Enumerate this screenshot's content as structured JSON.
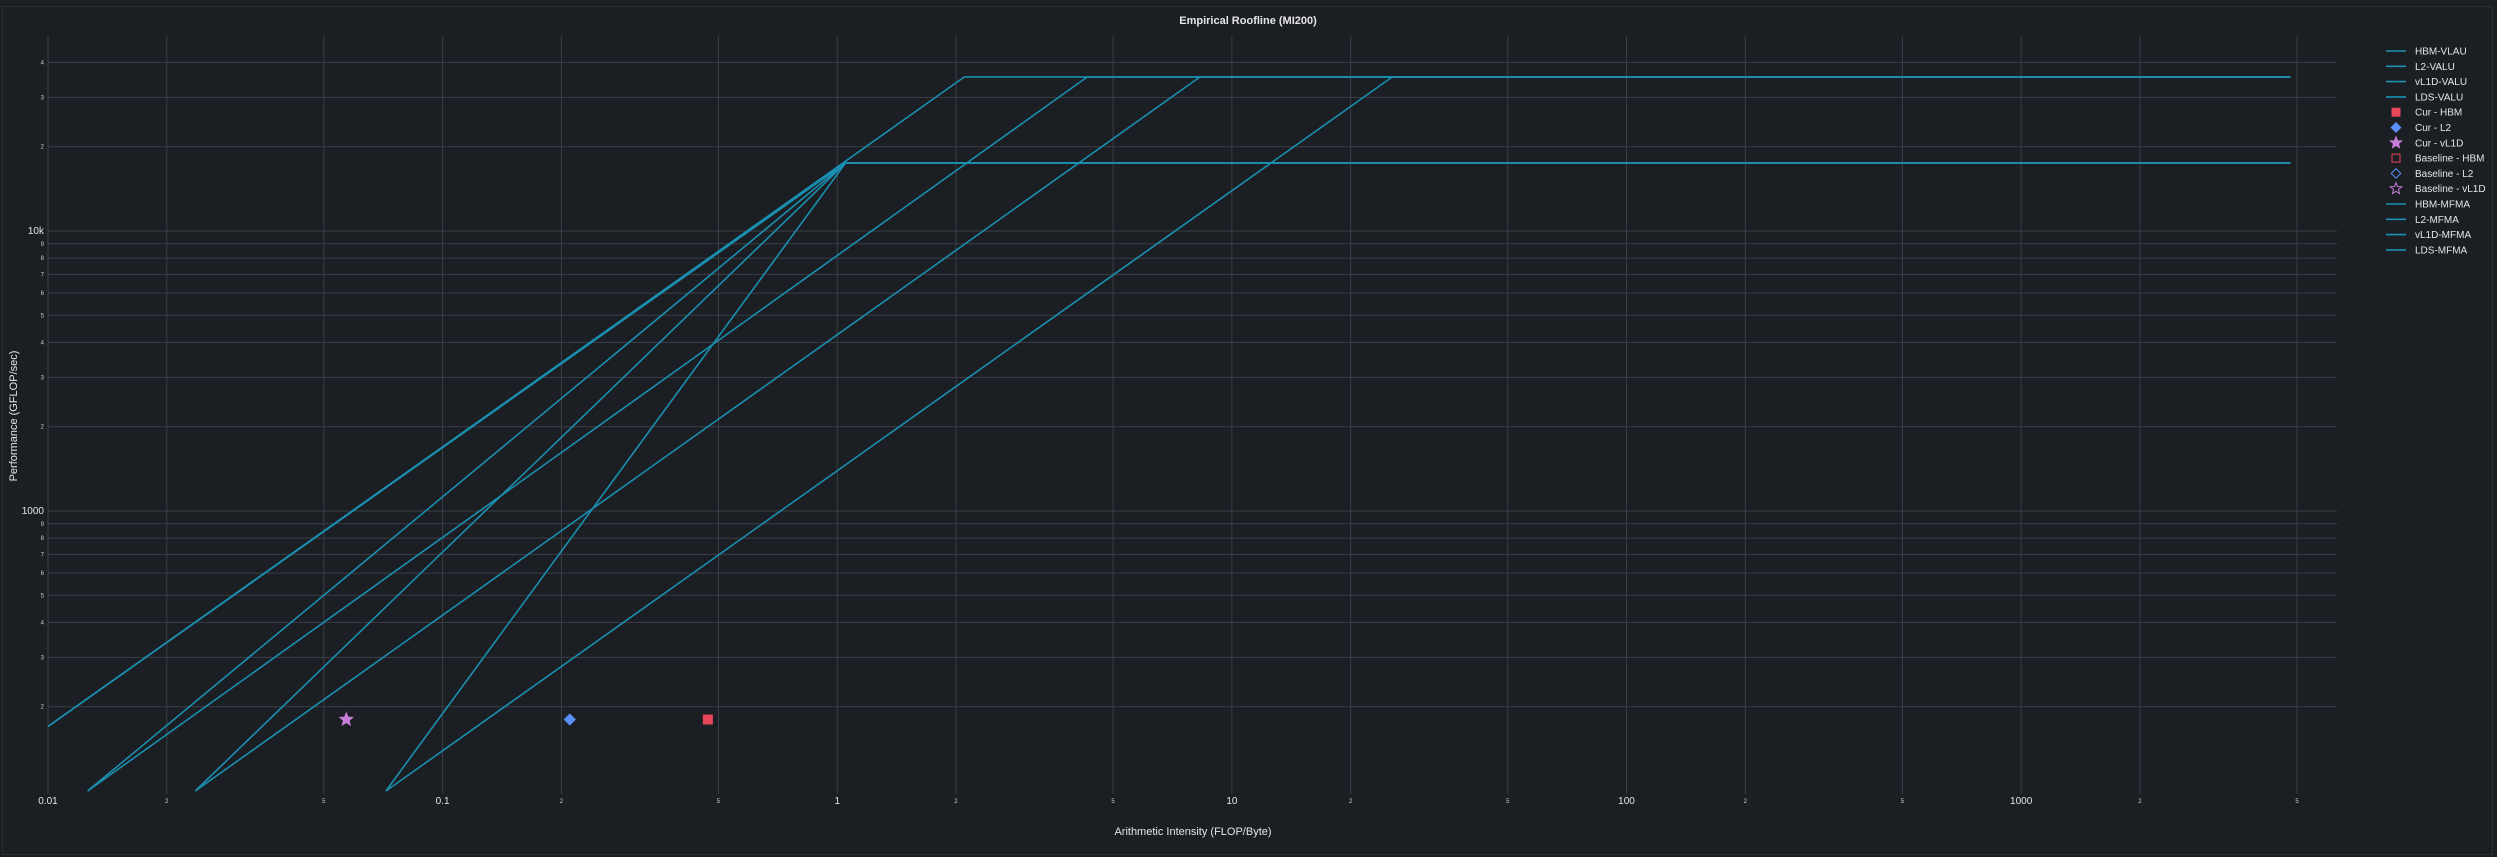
{
  "chart_data": {
    "type": "scatter",
    "title": "Empirical Roofline (MI200)",
    "xlabel": "Arithmetic Intensity (FLOP/Byte)",
    "ylabel": "Performance (GFLOP/sec)",
    "xscale": "log",
    "yscale": "log",
    "xlim": [
      0.01,
      5000
    ],
    "ylim": [
      100,
      4700
    ],
    "grid": true,
    "legend_position": "right",
    "x_major_ticks": [
      {
        "value": 0.01,
        "label": "0.01"
      },
      {
        "value": 0.1,
        "label": "0.1"
      },
      {
        "value": 1,
        "label": "1"
      },
      {
        "value": 10,
        "label": "10"
      },
      {
        "value": 100,
        "label": "100"
      },
      {
        "value": 1000,
        "label": "1000"
      }
    ],
    "x_minor_ticks": [
      {
        "value": 0.02,
        "label": "2"
      },
      {
        "value": 0.05,
        "label": "5"
      },
      {
        "value": 0.2,
        "label": "2"
      },
      {
        "value": 0.5,
        "label": "5"
      },
      {
        "value": 2,
        "label": "2"
      },
      {
        "value": 5,
        "label": "5"
      },
      {
        "value": 20,
        "label": "2"
      },
      {
        "value": 50,
        "label": "5"
      },
      {
        "value": 200,
        "label": "2"
      },
      {
        "value": 500,
        "label": "5"
      },
      {
        "value": 2000,
        "label": "2"
      },
      {
        "value": 5000,
        "label": "5"
      }
    ],
    "y_major_ticks": [
      {
        "value": 1000,
        "label": "1000"
      },
      {
        "value": 10000,
        "label": "10k"
      }
    ],
    "y_minor_ticks": [
      {
        "value": 200,
        "label": "2"
      },
      {
        "value": 300,
        "label": "3"
      },
      {
        "value": 400,
        "label": "4"
      },
      {
        "value": 500,
        "label": "5"
      },
      {
        "value": 600,
        "label": "6"
      },
      {
        "value": 700,
        "label": "7"
      },
      {
        "value": 800,
        "label": "8"
      },
      {
        "value": 900,
        "label": "9"
      },
      {
        "value": 2000,
        "label": "2"
      },
      {
        "value": 3000,
        "label": "3"
      },
      {
        "value": 4000,
        "label": "4"
      },
      {
        "value": 5000,
        "label": "5"
      },
      {
        "value": 6000,
        "label": "6"
      },
      {
        "value": 7000,
        "label": "7"
      },
      {
        "value": 8000,
        "label": "8"
      },
      {
        "value": 9000,
        "label": "9"
      },
      {
        "value": 20000,
        "label": "2"
      },
      {
        "value": 30000,
        "label": "3"
      },
      {
        "value": 40000,
        "label": "4"
      }
    ],
    "series": [
      {
        "name": "HBM-VLAU",
        "kind": "line",
        "color": "#1a8fb0",
        "x": [
          0.01,
          1.05,
          4810
        ],
        "y": [
          170,
          17500,
          17500
        ]
      },
      {
        "name": "L2-VALU",
        "kind": "line",
        "color": "#1a8fb0",
        "x": [
          0.0126,
          1.05,
          4810
        ],
        "y": [
          100,
          17500,
          17500
        ]
      },
      {
        "name": "vL1D-VALU",
        "kind": "line",
        "color": "#1a8fb0",
        "x": [
          0.0236,
          1.05,
          4810
        ],
        "y": [
          100,
          17500,
          17500
        ]
      },
      {
        "name": "LDS-VALU",
        "kind": "line",
        "color": "#1a8fb0",
        "x": [
          0.0718,
          1.05,
          4810
        ],
        "y": [
          100,
          17500,
          17500
        ]
      },
      {
        "name": "Cur - HBM",
        "kind": "marker",
        "marker": "square",
        "color": "#e8475a",
        "x": [
          0.47
        ],
        "y": [
          180
        ]
      },
      {
        "name": "Cur - L2",
        "kind": "marker",
        "marker": "diamond",
        "color": "#5b8ff9",
        "x": [
          0.21
        ],
        "y": [
          180
        ]
      },
      {
        "name": "Cur - vL1D",
        "kind": "marker",
        "marker": "star",
        "color": "#c77dd9",
        "x": [
          0.057
        ],
        "y": [
          180
        ]
      },
      {
        "name": "Baseline - HBM",
        "kind": "marker",
        "marker": "square-open",
        "color": "#e8475a",
        "x": [],
        "y": []
      },
      {
        "name": "Baseline - L2",
        "kind": "marker",
        "marker": "diamond-open",
        "color": "#5b8ff9",
        "x": [],
        "y": []
      },
      {
        "name": "Baseline - vL1D",
        "kind": "marker",
        "marker": "star-open",
        "color": "#c77dd9",
        "x": [],
        "y": []
      },
      {
        "name": "HBM-MFMA",
        "kind": "line",
        "color": "#1a8fb0",
        "x": [
          0.01,
          2.1,
          4810
        ],
        "y": [
          170,
          35500,
          35500
        ]
      },
      {
        "name": "L2-MFMA",
        "kind": "line",
        "color": "#1a8fb0",
        "x": [
          0.0126,
          4.3,
          4810
        ],
        "y": [
          100,
          35500,
          35500
        ]
      },
      {
        "name": "vL1D-MFMA",
        "kind": "line",
        "color": "#1a8fb0",
        "x": [
          0.0236,
          8.3,
          4810
        ],
        "y": [
          100,
          35500,
          35500
        ]
      },
      {
        "name": "LDS-MFMA",
        "kind": "line",
        "color": "#1a8fb0",
        "x": [
          0.0718,
          25.5,
          4810
        ],
        "y": [
          100,
          35500,
          35500
        ]
      }
    ]
  }
}
